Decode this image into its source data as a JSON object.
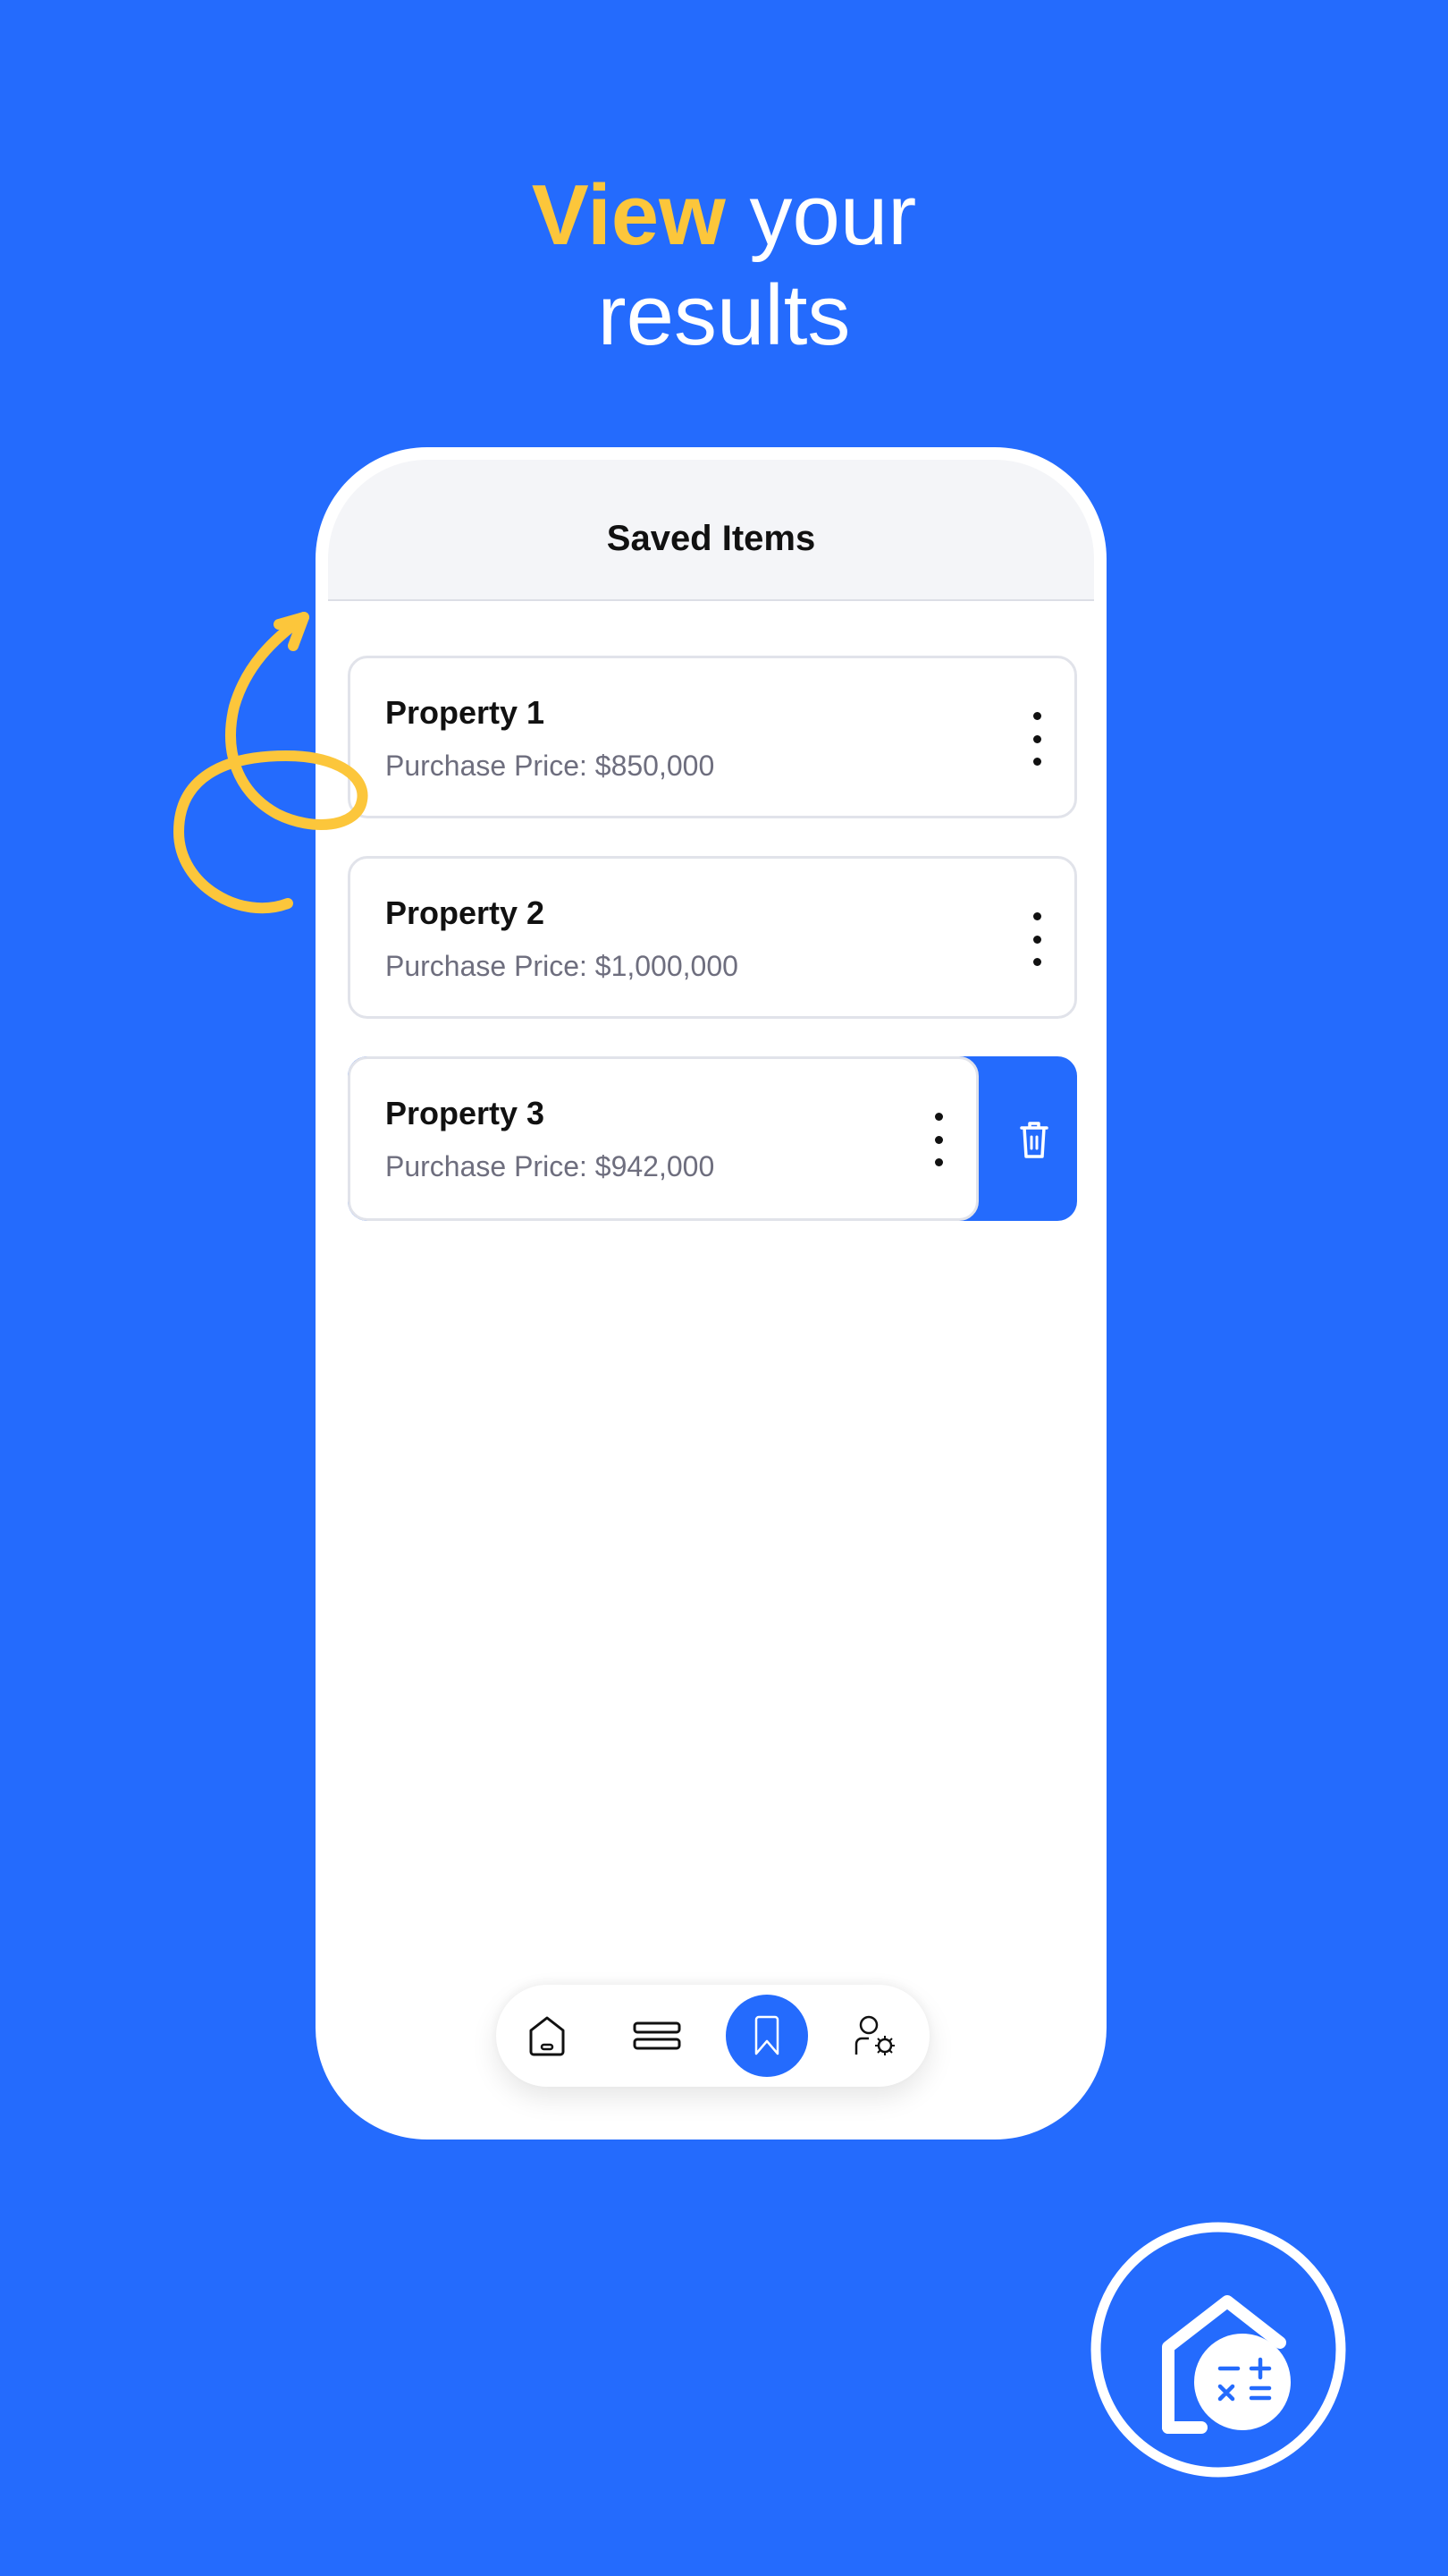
{
  "headline": {
    "highlight": "View",
    "rest_line1": " your",
    "line2": "results"
  },
  "colors": {
    "brand_blue": "#246bfd",
    "accent_yellow": "#fcc63b"
  },
  "screen": {
    "title": "Saved Items",
    "items": [
      {
        "name": "Property 1",
        "price": "Purchase Price: $850,000"
      },
      {
        "name": "Property 2",
        "price": "Purchase Price: $1,000,000"
      },
      {
        "name": "Property 3",
        "price": "Purchase Price: $942,000",
        "swiped_action": "trash-icon"
      }
    ]
  },
  "bottom_nav": {
    "items": [
      {
        "icon": "home-icon",
        "active": false
      },
      {
        "icon": "menu-icon",
        "active": false
      },
      {
        "icon": "bookmark-icon",
        "active": true
      },
      {
        "icon": "user-settings-icon",
        "active": false
      }
    ]
  },
  "logo": {
    "icon": "house-calculator-logo"
  }
}
